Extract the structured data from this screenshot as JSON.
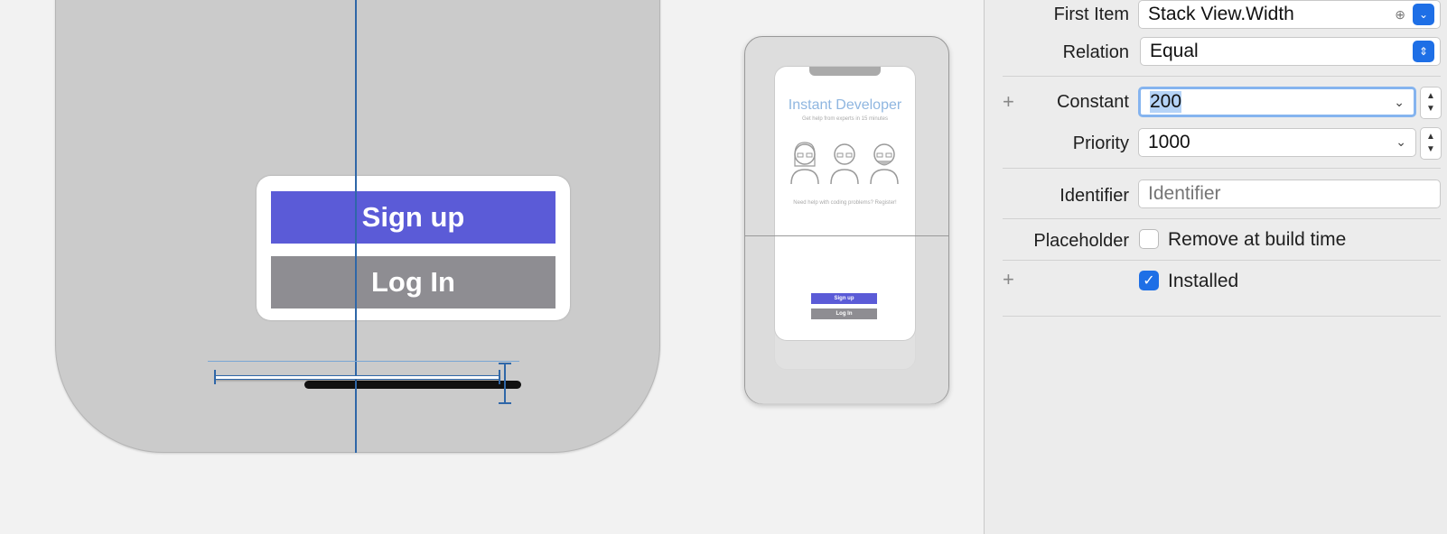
{
  "canvas": {
    "signup_label": "Sign up",
    "login_label": "Log In"
  },
  "preview": {
    "title": "Instant Developer",
    "subtitle": "Get help from experts in 15 minutes",
    "caption": "Need help with coding problems? Register!",
    "signup_label": "Sign up",
    "login_label": "Log In"
  },
  "inspector": {
    "first_item_label": "First Item",
    "first_item_value": "Stack View.Width",
    "relation_label": "Relation",
    "relation_value": "Equal",
    "constant_label": "Constant",
    "constant_value": "200",
    "priority_label": "Priority",
    "priority_value": "1000",
    "identifier_label": "Identifier",
    "identifier_placeholder": "Identifier",
    "placeholder_label": "Placeholder",
    "remove_build_label": "Remove at build time",
    "remove_build_checked": false,
    "installed_label": "Installed",
    "installed_checked": true
  },
  "colors": {
    "accent": "#1e6fe6",
    "signup": "#5b5bd7",
    "login": "#8e8d92",
    "guide": "#2f67a8"
  }
}
